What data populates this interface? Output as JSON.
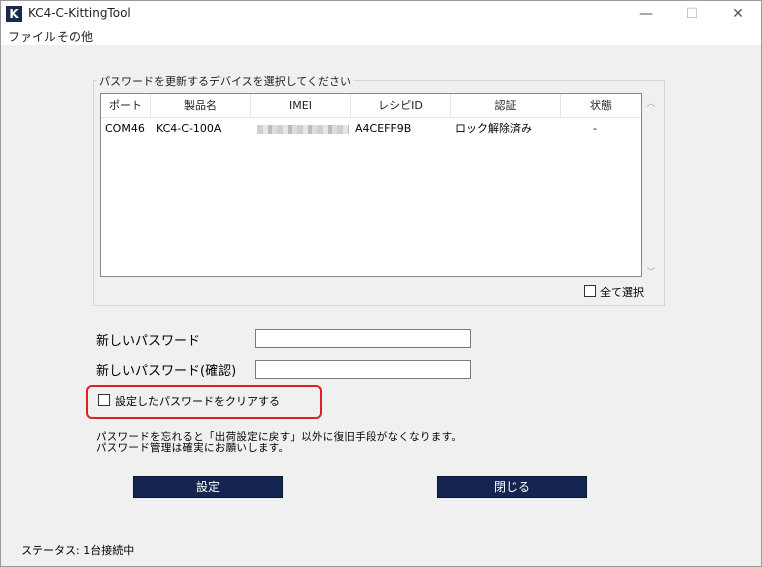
{
  "window": {
    "title": "KC4-C-KittingTool",
    "icon_letter": "K",
    "controls": {
      "minimize": "—",
      "maximize": "☐",
      "close": "✕"
    }
  },
  "menu": [
    "ファイル",
    "その他"
  ],
  "device_group": {
    "title": "パスワードを更新するデバイスを選択してください",
    "columns": [
      "ポート",
      "製品名",
      "IMEI",
      "レシピID",
      "認証",
      "状態"
    ],
    "rows": [
      {
        "port": "COM46",
        "product": "KC4-C-100A",
        "imei": "",
        "recipe_id": "A4CEFF9B",
        "auth": "ロック解除済み",
        "state": "-"
      }
    ],
    "select_all_label": "全て選択",
    "select_all_checked": false
  },
  "password": {
    "new_label": "新しいパスワード",
    "new_value": "",
    "confirm_label": "新しいパスワード(確認)",
    "confirm_value": ""
  },
  "clear_option": {
    "label": "設定したパスワードをクリアする",
    "checked": false
  },
  "notice": {
    "line1": "パスワードを忘れると「出荷設定に戻す」以外に復旧手段がなくなります。",
    "line2": "パスワード管理は確実にお願いします。"
  },
  "buttons": {
    "set": "設定",
    "close": "閉じる"
  },
  "status": {
    "text": "ステータス: 1台接続中"
  }
}
